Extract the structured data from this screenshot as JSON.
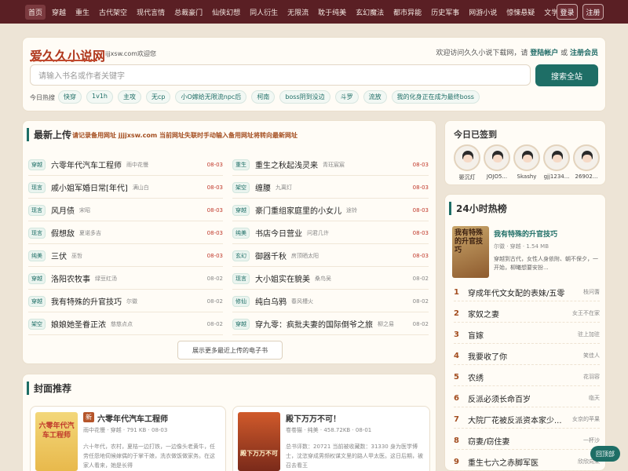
{
  "nav": {
    "items": [
      "首页",
      "穿越",
      "重生",
      "古代架空",
      "现代言情",
      "总裁豪门",
      "仙侠幻想",
      "同人衍生",
      "无限流",
      "耽于纯美",
      "玄幻魔法",
      "都市异能",
      "历史军事",
      "网游小说",
      "惊悚悬疑",
      "文学名著"
    ],
    "login": "登录",
    "register": "注册"
  },
  "header": {
    "brand": "爱久久小说网",
    "domain_tip": "ijjxsw.com欢迎您",
    "welcome_prefix": "欢迎访问久久小说下载网，请",
    "login_link": "登陆帐户",
    "or": "或",
    "register_link": "注册会员"
  },
  "search": {
    "placeholder": "请输入书名或作者关键字",
    "button": "搜索全站",
    "hot_label": "今日热搜",
    "hot_tags": [
      "快穿",
      "1v1h",
      "主攻",
      "无cp",
      "小O嫁给无限流npc后",
      "柯南",
      "boss阴到没边",
      "斗罗",
      "流放",
      "我的化身正在成为最终boss"
    ]
  },
  "latest": {
    "title": "最新上传",
    "notice": "请记录备用网址 jjjjxsw.com 当前网址失联时手动输入备用网址将转向最新网址",
    "left": [
      {
        "cat": "穿越",
        "name": "六零年代汽车工程师",
        "author": "雨中花慢",
        "date": "08-03",
        "red": true
      },
      {
        "cat": "现言",
        "name": "戚小姐军婚日常[年代]",
        "author": "满山白",
        "date": "08-03",
        "red": true
      },
      {
        "cat": "现言",
        "name": "风月债",
        "author": "宋昭",
        "date": "08-03",
        "red": true
      },
      {
        "cat": "现言",
        "name": "假想敌",
        "author": "夏诺多吉",
        "date": "08-03",
        "red": true
      },
      {
        "cat": "纯美",
        "name": "三伏",
        "author": "巫哲",
        "date": "08-03",
        "red": true
      },
      {
        "cat": "穿越",
        "name": "洛阳农牧事",
        "author": "绿豆红汤",
        "date": "08-02",
        "red": false
      },
      {
        "cat": "穿越",
        "name": "我有特殊的升官技巧",
        "author": "尔徽",
        "date": "08-02",
        "red": false
      },
      {
        "cat": "架空",
        "name": "娘娘她圣眷正浓",
        "author": "慈慈点点",
        "date": "08-02",
        "red": false
      }
    ],
    "right": [
      {
        "cat": "重生",
        "name": "重生之秋起浅灵来",
        "author": "青珏宸宸",
        "date": "08-03",
        "red": true
      },
      {
        "cat": "架空",
        "name": "缠腰",
        "author": "九离灯",
        "date": "08-03",
        "red": true
      },
      {
        "cat": "穿越",
        "name": "豪门重组家庭里的小女儿",
        "author": "途铃",
        "date": "08-03",
        "red": true
      },
      {
        "cat": "纯美",
        "name": "书店今日营业",
        "author": "问君几许",
        "date": "08-03",
        "red": true
      },
      {
        "cat": "玄幻",
        "name": "御器千秋",
        "author": "房顶晒太阳",
        "date": "08-03",
        "red": true
      },
      {
        "cat": "现言",
        "name": "大小姐实在貌美",
        "author": "桑鸟吴",
        "date": "08-02",
        "red": false
      },
      {
        "cat": "修仙",
        "name": "纯白乌鸦",
        "author": "春风槽火",
        "date": "08-02",
        "red": false
      },
      {
        "cat": "穿越",
        "name": "穿九零：疯批夫妻的国际倒爷之旅",
        "author": "柳之易",
        "date": "08-02",
        "red": false
      }
    ],
    "more": "展示更多最近上传的电子书"
  },
  "checkin": {
    "title": "今日已签到",
    "users": [
      "晏沉灯",
      "JOJO5...",
      "Skashy",
      "gjj1234...",
      "26902..."
    ]
  },
  "hot24": {
    "title": "24小时热榜",
    "top": {
      "name": "我有特殊的升官技巧",
      "meta": "尔徽 · 穿越 · 1.54 MB",
      "desc": "穿越到古代，女性人身依附、朝不保夕，一开始，柳曦想要安扮...",
      "cover_text": "我有特殊的升官技巧"
    },
    "items": [
      {
        "rank": "1",
        "name": "穿成年代文女配的表妹/五零",
        "author": "枝问蓍"
      },
      {
        "rank": "2",
        "name": "家奴之妻",
        "author": "女王不在家"
      },
      {
        "rank": "3",
        "name": "盲嫁",
        "author": "驻上加驻"
      },
      {
        "rank": "4",
        "name": "我要收了你",
        "author": "笑佳人"
      },
      {
        "rank": "5",
        "name": "农绣",
        "author": "花羽容"
      },
      {
        "rank": "6",
        "name": "反派必须长命百岁",
        "author": "临天"
      },
      {
        "rank": "7",
        "name": "大院厂花被反派资本家少...",
        "author": "女京的苹果"
      },
      {
        "rank": "8",
        "name": "窃妻/窃住妻",
        "author": "一杯沙"
      },
      {
        "rank": "9",
        "name": "重生七六之赤脚军医",
        "author": "欣欣向荣"
      }
    ]
  },
  "covers": {
    "title": "封面推荐",
    "items": [
      {
        "badge": "新",
        "name": "六零年代汽车工程师",
        "meta": "雨中花慢 · 穿越 · 791 KB · 08-03",
        "desc": "六十年代，农村，夏桔一边打铁，一边像头老黄牛，任劳任怨地伺候嫁偶的于掌干娘，洗衣做饭做家务。在这家人看来，她是长得",
        "cover_text": "六零年代汽车工程师"
      },
      {
        "name": "殿下万万不可！",
        "meta": "卷卷猫 · 纯美 · 458.72KB · 08-01",
        "desc": "总书评数：20721 当前被收藏数：31330 身为医学博士，沈恣穿成男频权谋文里的路人甲太医。这日后期，被召去看王",
        "cover_text": "殿下万万不可"
      }
    ]
  },
  "back_top": "回顶部",
  "colors": {
    "nav_bg": "#5a1f24",
    "accent": "#1e6e66",
    "brand": "#b0381e",
    "page_bg": "#ede4d6"
  }
}
